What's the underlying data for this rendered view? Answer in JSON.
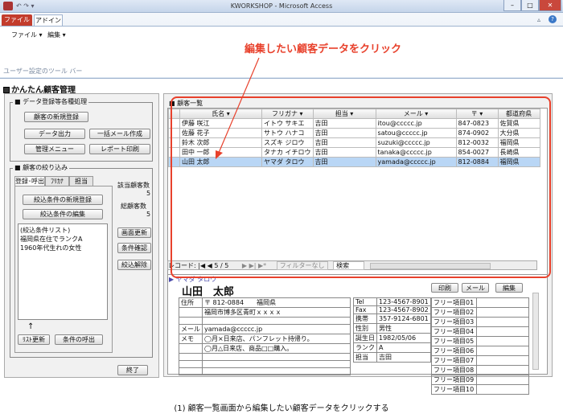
{
  "window": {
    "title": "KWORKSHOP - Microsoft Access",
    "minimize": "–",
    "maximize": "□",
    "close": "✕"
  },
  "ribbon": {
    "tab_file": "ファイル",
    "tab_addin": "アドイン",
    "menu_file": "ファイル ▾",
    "menu_edit": "編集 ▾",
    "group_label": "ユーザー設定のツール バー",
    "help": "?"
  },
  "app": {
    "title": "かんたん顧客管理"
  },
  "left": {
    "section1_title": "データ登録等各種処理",
    "btn_new": "顧客の新規登録",
    "btn_output": "データ出力",
    "btn_mail": "一括メール作成",
    "btn_menu": "管理メニュー",
    "btn_report": "レポート印刷",
    "section2_title": "顧客の絞り込み",
    "tabs": [
      "登録･呼出",
      "ﾌﾘｶﾅ",
      "担当"
    ],
    "btn_filter_new": "絞込条件の新規登録",
    "btn_filter_edit": "絞込条件の編集",
    "list_header": "(絞込条件リスト)",
    "list_items": [
      "福岡県在住でランクA",
      "1960年代生れの女性"
    ],
    "count_label": "該当顧客数",
    "count_value": "5",
    "total_label": "総顧客数",
    "total_value": "5",
    "btn_refresh": "画面更新",
    "btn_confirm": "条件確認",
    "btn_clear": "絞込解除",
    "btn_list_update": "ﾘｽﾄ更新",
    "btn_call": "条件の呼出",
    "arrow_glyph": "↑",
    "btn_exit": "終了"
  },
  "customers": {
    "title": "顧客一覧",
    "columns": [
      "氏名",
      "フリガナ",
      "担当",
      "メール",
      "〒",
      "都道府県"
    ],
    "rows": [
      [
        "伊藤 咲江",
        "イトウ サキエ",
        "吉田",
        "itou@ccccc.jp",
        "847-0823",
        "佐賀県"
      ],
      [
        "佐藤 花子",
        "サトウ ハナコ",
        "吉田",
        "satou@ccccc.jp",
        "874-0902",
        "大分県"
      ],
      [
        "鈴木 次郎",
        "スズキ ジロウ",
        "吉田",
        "suzuki@ccccc.jp",
        "812-0032",
        "福岡県"
      ],
      [
        "田中 一郎",
        "タナカ イチロウ",
        "吉田",
        "tanaka@ccccc.jp",
        "854-0027",
        "長崎県"
      ],
      [
        "山田 太郎",
        "ヤマダ タロウ",
        "吉田",
        "yamada@ccccc.jp",
        "812-0884",
        "福岡県"
      ]
    ],
    "nav_label": "レコード:",
    "nav_first": "|◀",
    "nav_prev": "◀",
    "nav_position": "5 / 5",
    "nav_next": "▶",
    "nav_last": "▶|",
    "nav_new": "▶*",
    "nav_filter": "フィルターなし",
    "nav_search": "検索"
  },
  "detail": {
    "kana": "ヤマダ タロウ",
    "name": "山田　太郎",
    "btn_print": "印刷",
    "btn_mail": "メール",
    "btn_edit": "編集",
    "address_label": "住所",
    "postal": "〒 812-0884　　福岡県",
    "address": "福岡市博多区青町ｘｘｘｘ",
    "mail_label": "メール",
    "mail": "yamada@ccccc.jp",
    "memo_label": "メモ",
    "memo_lines": [
      "◯月×日来店、パンフレット持帰り。",
      "◯月△日来店、商品□□購入。"
    ],
    "info_labels": [
      "Tel",
      "Fax",
      "携帯",
      "性別",
      "誕生日",
      "ランク",
      "担当"
    ],
    "info_values": [
      "123-4567-8901",
      "123-4567-8902",
      "357-9124-6801",
      "男性",
      "1982/05/06",
      "A",
      "吉田"
    ],
    "free_items": [
      "フリー項目01",
      "フリー項目02",
      "フリー項目03",
      "フリー項目04",
      "フリー項目05",
      "フリー項目06",
      "フリー項目07",
      "フリー項目08",
      "フリー項目09",
      "フリー項目10"
    ]
  },
  "annotation": "編集したい顧客データをクリック",
  "caption": "(1) 顧客一覧画面から編集したい顧客データをクリックする",
  "colors": {
    "annotation": "#e8412c",
    "selected_row": "#b9d6f5",
    "file_tab": "#c33c2c"
  }
}
